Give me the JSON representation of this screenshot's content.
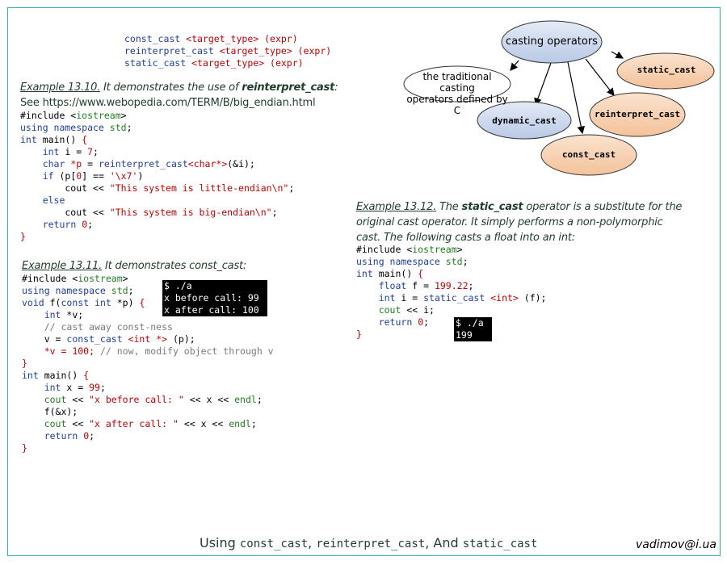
{
  "syntax": [
    {
      "name": "const_cast",
      "args": " <target_type> (expr)"
    },
    {
      "name": "reinterpret_cast",
      "args": " <target_type> (expr)"
    },
    {
      "name": "static_cast",
      "args": " <target_type> (expr)"
    }
  ],
  "diagram": {
    "root": "casting operators",
    "traditional": [
      "the traditional casting",
      "operators defined by C"
    ],
    "nodes": [
      "static_cast",
      "reinterpret_cast",
      "dynamic_cast",
      "const_cast"
    ]
  },
  "ex10": {
    "label": "Example 13.10.",
    "text_a": " It demonstrates the use of ",
    "bold": "reinterpret_cast",
    "text_b": ":",
    "see": "See https://www.webopedia.com/TERM/B/big_endian.html"
  },
  "ex11": {
    "label": "Example 13.11.",
    "text": " It demonstrates const_cast:"
  },
  "ex12": {
    "label": "Example 13.12.",
    "text_a": " The ",
    "bold": "static_cast",
    "text_b": " operator is a substitute for the",
    "line2": "original cast operator. It simply performs a non-polymorphic",
    "line3": "cast. The following casts a float into an int:"
  },
  "terminal1": [
    "$ ./a",
    "x before call: 99",
    "x after call: 100"
  ],
  "terminal2": [
    "$ ./a",
    "199"
  ],
  "footer": {
    "using": "Using ",
    "c1": "const_cast",
    "sep1": ", ",
    "c2": "reinterpret_cast",
    "sep2": ", And ",
    "c3": "static_cast"
  },
  "author": "vadimov@i.ua",
  "colors": {
    "frame": "#2fb3b3",
    "code_red": "#c00000",
    "code_blue": "#1f3fa0",
    "code_green": "#207d20",
    "terminal_bg": "#000000",
    "node_blue": "#c9d6ec",
    "node_orange": "#f7cfae"
  }
}
